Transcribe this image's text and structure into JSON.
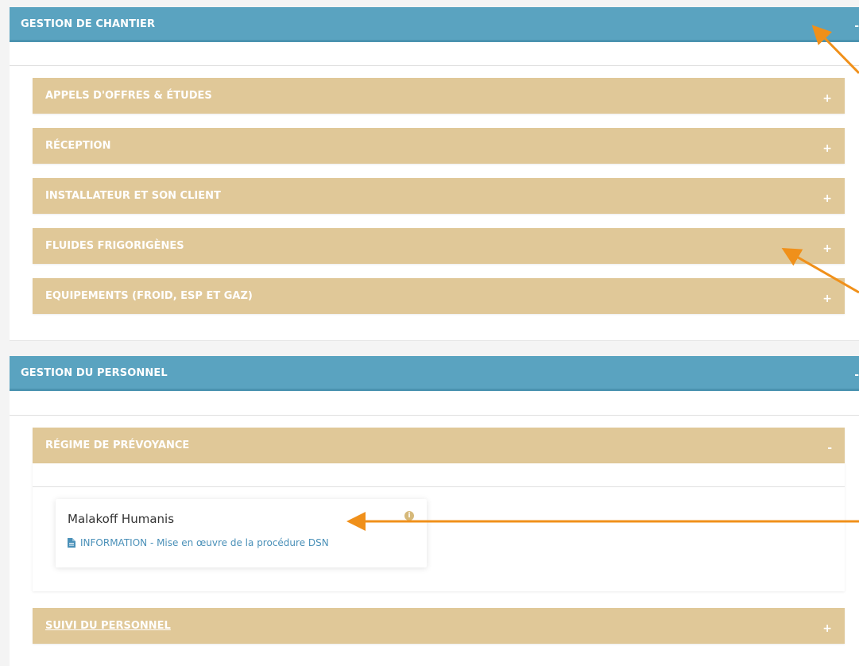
{
  "sections": [
    {
      "title": "GESTION DE CHANTIER",
      "toggle": "-",
      "items": [
        {
          "label": "APPELS D'OFFRES & ÉTUDES",
          "toggle": "+"
        },
        {
          "label": "RÉCEPTION",
          "toggle": "+"
        },
        {
          "label": "INSTALLATEUR ET SON CLIENT",
          "toggle": "+"
        },
        {
          "label": "FLUIDES FRIGORIGÈNES",
          "toggle": "+"
        },
        {
          "label": "EQUIPEMENTS (FROID, ESP ET GAZ)",
          "toggle": "+"
        }
      ]
    },
    {
      "title": "GESTION DU PERSONNEL",
      "toggle": "-",
      "items": [
        {
          "label": "RÉGIME DE PRÉVOYANCE",
          "toggle": "-"
        },
        {
          "label": "SUIVI DU PERSONNEL",
          "toggle": "+"
        }
      ]
    }
  ],
  "card": {
    "title": "Malakoff Humanis",
    "info_icon": "i",
    "link_label": "INFORMATION - Mise en œuvre de la procédure DSN",
    "icon_name": "document-icon"
  },
  "colors": {
    "section_header": "#5aa3c0",
    "sub_bar": "#e0c898",
    "arrow": "#f0901a",
    "link": "#4a90b8"
  }
}
